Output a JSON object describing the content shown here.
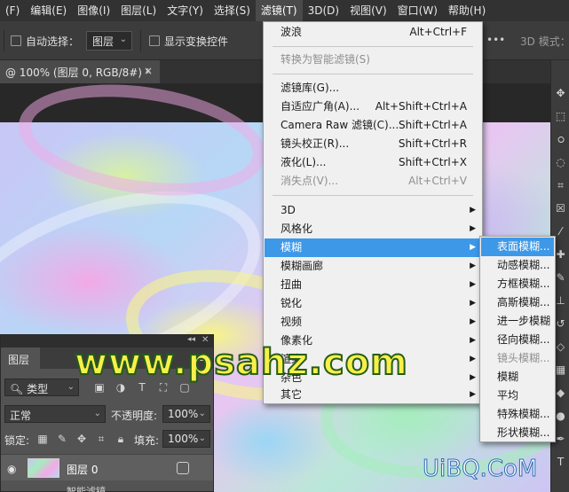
{
  "menubar": {
    "items": [
      "(F)",
      "编辑(E)",
      "图像(I)",
      "图层(L)",
      "文字(Y)",
      "选择(S)",
      "滤镜(T)",
      "3D(D)",
      "视图(V)",
      "窗口(W)",
      "帮助(H)"
    ],
    "active_item": "滤镜(T)"
  },
  "options": {
    "auto_select_label": "自动选择：",
    "auto_select_value": "图层",
    "show_transform_label": "显示变换控件",
    "mode_3d_label": "3D 模式："
  },
  "document": {
    "tab_title": "@ 100% (图层 0, RGB/8#) *",
    "close_glyph": "×"
  },
  "filter_menu": {
    "items": [
      {
        "label": "波浪",
        "shortcut": "Alt+Ctrl+F",
        "disabled": false
      },
      {
        "label": "转换为智能滤镜(S)",
        "shortcut": "",
        "disabled": true
      },
      {
        "label": "滤镜库(G)...",
        "shortcut": "",
        "disabled": false
      },
      {
        "label": "自适应广角(A)...",
        "shortcut": "Alt+Shift+Ctrl+A",
        "disabled": false
      },
      {
        "label": "Camera Raw 滤镜(C)...",
        "shortcut": "Shift+Ctrl+A",
        "disabled": false
      },
      {
        "label": "镜头校正(R)...",
        "shortcut": "Shift+Ctrl+R",
        "disabled": false
      },
      {
        "label": "液化(L)...",
        "shortcut": "Shift+Ctrl+X",
        "disabled": false
      },
      {
        "label": "消失点(V)...",
        "shortcut": "Alt+Ctrl+V",
        "disabled": true
      }
    ],
    "groups": [
      "3D",
      "风格化",
      "模糊",
      "模糊画廊",
      "扭曲",
      "锐化",
      "视频",
      "像素化",
      "渲染",
      "杂色",
      "其它"
    ],
    "highlighted_group": "模糊"
  },
  "blur_submenu": {
    "items": [
      "表面模糊...",
      "动感模糊...",
      "方框模糊...",
      "高斯模糊...",
      "进一步模糊",
      "径向模糊...",
      "镜头模糊...",
      "模糊",
      "平均",
      "特殊模糊...",
      "形状模糊..."
    ],
    "highlighted": "表面模糊...",
    "disabled": [
      "镜头模糊..."
    ]
  },
  "layers_panel": {
    "tab_label": "图层",
    "filter_kind": "类型",
    "blend_mode": "正常",
    "opacity_label": "不透明度:",
    "opacity_value": "100%",
    "lock_label": "锁定:",
    "fill_label": "填充:",
    "fill_value": "100%",
    "layer_name": "图层 0",
    "sub_label": "智能滤镜"
  },
  "watermarks": {
    "main": "www.psahz.com",
    "corner": "UiBQ.CoM"
  },
  "colors": {
    "menu_highlight": "#3d98e8",
    "watermark_fill": "#f7f04a",
    "watermark_stroke": "#255c18"
  }
}
